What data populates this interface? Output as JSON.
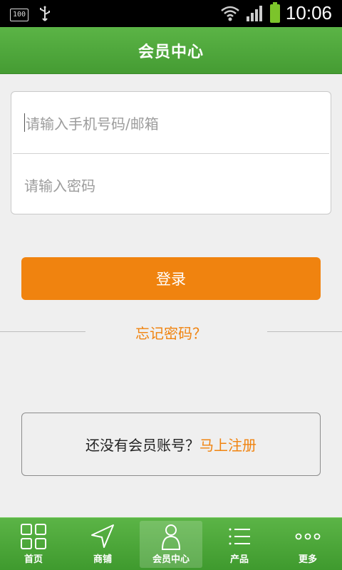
{
  "status_bar": {
    "battery_small_text": "100",
    "time": "10:06"
  },
  "header": {
    "title": "会员中心"
  },
  "login": {
    "phone_placeholder": "请输入手机号码/邮箱",
    "password_placeholder": "请输入密码",
    "login_label": "登录",
    "forgot_label": "忘记密码？"
  },
  "register": {
    "prompt": "还没有会员账号？",
    "link": "马上注册"
  },
  "tabbar": {
    "items": [
      {
        "label": "首页",
        "icon": "grid-icon"
      },
      {
        "label": "商铺",
        "icon": "navigation-arrow-icon"
      },
      {
        "label": "会员中心",
        "icon": "person-icon",
        "active": true
      },
      {
        "label": "产品",
        "icon": "list-icon"
      },
      {
        "label": "更多",
        "icon": "more-dots-icon"
      }
    ]
  },
  "colors": {
    "header_green": "#4fa83c",
    "accent_orange": "#f0830f",
    "background": "#efefef"
  }
}
